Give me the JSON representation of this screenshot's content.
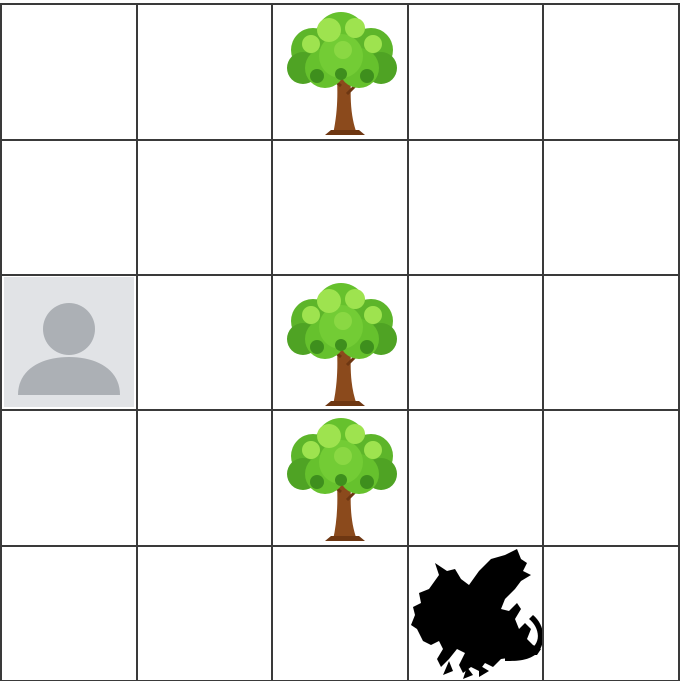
{
  "board": {
    "rows": 5,
    "cols": 5,
    "cells": [
      [
        "empty",
        "empty",
        "tree",
        "empty",
        "empty"
      ],
      [
        "empty",
        "empty",
        "empty",
        "empty",
        "empty"
      ],
      [
        "player",
        "empty",
        "tree",
        "empty",
        "empty"
      ],
      [
        "empty",
        "empty",
        "tree",
        "empty",
        "empty"
      ],
      [
        "empty",
        "empty",
        "empty",
        "dragon",
        "empty"
      ]
    ]
  },
  "pieces": {
    "player": {
      "icon": "user-avatar-icon",
      "background": "#e1e3e6",
      "figure": "#acb0b5"
    },
    "tree": {
      "icon": "tree-icon",
      "leaf": "#66c12d",
      "leaf_light": "#9ee34f",
      "leaf_dark": "#3e8f1d",
      "trunk": "#8b4a1c"
    },
    "dragon": {
      "icon": "dragon-icon",
      "color": "#000000"
    }
  },
  "colors": {
    "grid_line": "#3a3a3a",
    "cell_bg": "#ffffff"
  }
}
